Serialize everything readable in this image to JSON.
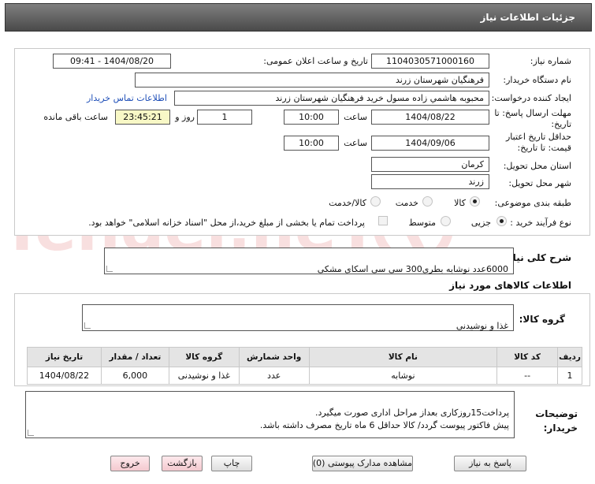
{
  "header": {
    "title": "جزئیات اطلاعات نیاز"
  },
  "form": {
    "need_number_label": "شماره نیاز:",
    "need_number": "1104030571000160",
    "announce_label": "تاریخ و ساعت اعلان عمومی:",
    "announce_value": "1404/08/20 - 09:41",
    "buyer_org_label": "نام دستگاه خریدار:",
    "buyer_org": "فرهنگیان شهرستان زرند",
    "creator_label": "ایجاد کننده درخواست:",
    "creator": "محبوبه هاشمي زاده مسول خريد فرهنگيان شهرستان زرند",
    "contact_link": "اطلاعات تماس خریدار",
    "deadline_label_1": "مهلت ارسال پاسخ: تا",
    "deadline_label_2": "تاریخ:",
    "deadline_date": "1404/08/22",
    "time_label": "ساعت",
    "deadline_time": "10:00",
    "days_value": "1",
    "days_label": "روز و",
    "remaining_time": "23:45:21",
    "remaining_label": "ساعت باقی مانده",
    "validity_label_1": "حداقل تاریخ اعتبار",
    "validity_label_2": "قیمت: تا تاریخ:",
    "validity_date": "1404/09/06",
    "validity_time": "10:00",
    "province_label": "استان محل تحویل:",
    "province": "کرمان",
    "city_label": "شهر محل تحویل:",
    "city": "زرند",
    "category_label": "طبقه بندی موضوعی:",
    "category_options": [
      "کالا",
      "خدمت",
      "کالا/خدمت"
    ],
    "process_label": "نوع فرآیند خرید :",
    "process_options": [
      "جزیی",
      "متوسط"
    ],
    "payment_note": "پرداخت تمام یا بخشی از مبلغ خرید،از محل \"اسناد خزانه اسلامی\" خواهد بود."
  },
  "summary": {
    "label": "شرح کلی نیاز:",
    "value": "6000عدد نوشابه بطری300 سی سی اسکای مشکی"
  },
  "goods": {
    "section_title": "اطلاعات کالاهای مورد نیاز",
    "group_label": "گروه کالا:",
    "group_value": "غذا و نوشیدنی",
    "columns": [
      "ردیف",
      "کد کالا",
      "نام کالا",
      "واحد شمارش",
      "گروه کالا",
      "تعداد / مقدار",
      "تاریخ نیاز"
    ],
    "rows": [
      [
        "1",
        "--",
        "نوشابه",
        "عدد",
        "غذا و نوشیدنی",
        "6,000",
        "1404/08/22"
      ]
    ]
  },
  "notes": {
    "label_1": "توضیحات",
    "label_2": "خریدار:",
    "value": "پرداخت15روزکاری بعداز مراحل اداری صورت میگیرد.\nپیش فاکتور پیوست گردد/ کالا حداقل 6 ماه تاریخ مصرف داشته باشد."
  },
  "buttons": {
    "reply": "پاسخ به نیاز",
    "attachments": "مشاهده مدارک پیوستی (0)",
    "print": "چاپ",
    "back": "بازگشت",
    "exit": "خروج"
  },
  "watermark_text": "AriaTender.neT"
}
